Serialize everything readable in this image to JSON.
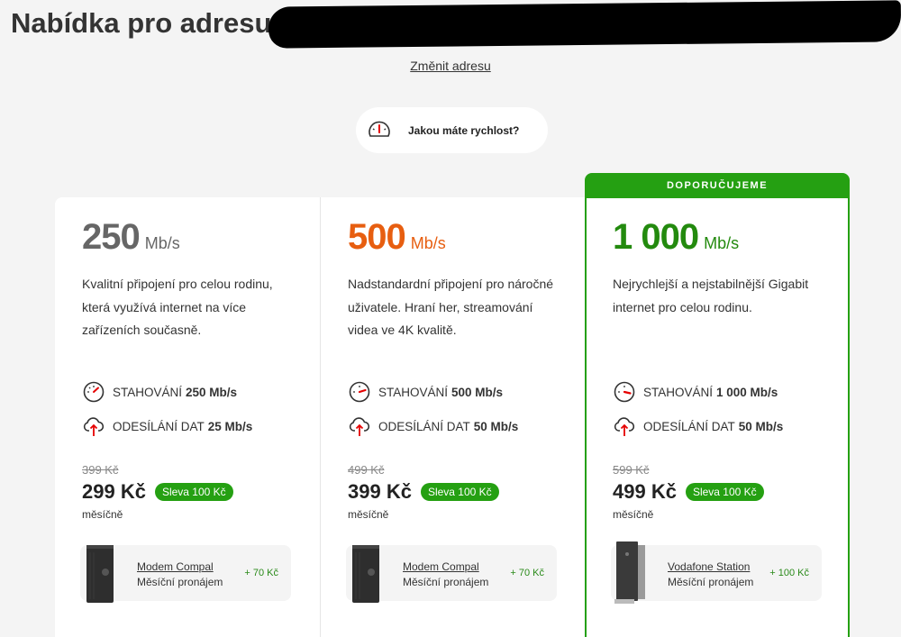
{
  "header": {
    "title": "Nabídka pro adresu"
  },
  "change_address_link": "Změnit adresu",
  "speed_question": {
    "label": "Jakou máte rychlost?",
    "icon": "speedometer-icon"
  },
  "recommended_badge": "DOPORUČUJEME",
  "colors": {
    "green": "#25a012",
    "orange": "#e75e10",
    "grey": "#666666",
    "red": "#e60000"
  },
  "plans": [
    {
      "speed": "250",
      "unit": "Mb/s",
      "description": "Kvalitní připojení pro celou rodinu, která využívá internet na více zařízeních současně.",
      "download_label": "STAHOVÁNÍ",
      "download_value": "250 Mb/s",
      "upload_label": "ODESÍLÁNÍ DAT",
      "upload_value": "25 Mb/s",
      "old_price": "399 Kč",
      "price": "299 Kč",
      "discount": "Sleva 100 Kč",
      "period": "měsíčně",
      "device_name": "Modem Compal",
      "device_sub": "Měsíční pronájem",
      "device_price": "+ 70 Kč"
    },
    {
      "speed": "500",
      "unit": "Mb/s",
      "description": "Nadstandardní připojení pro náročné uživatele. Hraní her, streamování videa ve 4K kvalitě.",
      "download_label": "STAHOVÁNÍ",
      "download_value": "500 Mb/s",
      "upload_label": "ODESÍLÁNÍ DAT",
      "upload_value": "50 Mb/s",
      "old_price": "499 Kč",
      "price": "399 Kč",
      "discount": "Sleva 100 Kč",
      "period": "měsíčně",
      "device_name": "Modem Compal",
      "device_sub": "Měsíční pronájem",
      "device_price": "+ 70 Kč"
    },
    {
      "speed": "1 000",
      "unit": "Mb/s",
      "description": "Nejrychlejší a nejstabilnější Gigabit internet pro celou rodinu.",
      "download_label": "STAHOVÁNÍ",
      "download_value": "1 000 Mb/s",
      "upload_label": "ODESÍLÁNÍ DAT",
      "upload_value": "50 Mb/s",
      "old_price": "599 Kč",
      "price": "499 Kč",
      "discount": "Sleva 100 Kč",
      "period": "měsíčně",
      "device_name": "Vodafone Station",
      "device_sub": "Měsíční pronájem",
      "device_price": "+ 100 Kč"
    }
  ]
}
